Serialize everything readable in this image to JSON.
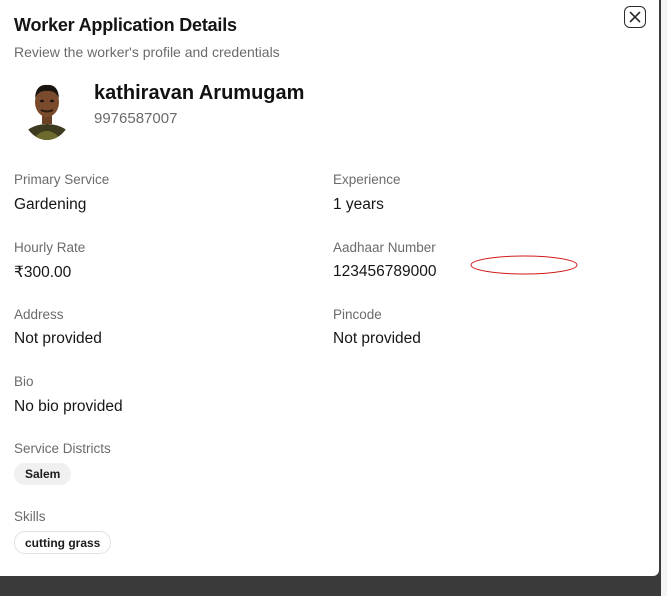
{
  "dialog": {
    "title": "Worker Application Details",
    "subtitle": "Review the worker's profile and credentials",
    "close_icon": "close-icon"
  },
  "worker": {
    "name": "kathiravan Arumugam",
    "phone": "9976587007",
    "avatar_icon": "worker-photo"
  },
  "fields": {
    "primary_service": {
      "label": "Primary Service",
      "value": "Gardening"
    },
    "experience": {
      "label": "Experience",
      "value": "1 years"
    },
    "hourly_rate": {
      "label": "Hourly Rate",
      "value": "₹300.00"
    },
    "aadhaar": {
      "label": "Aadhaar Number",
      "value": "123456789000"
    },
    "address": {
      "label": "Address",
      "value": "Not provided"
    },
    "pincode": {
      "label": "Pincode",
      "value": "Not provided"
    },
    "bio": {
      "label": "Bio",
      "value": "No bio provided"
    }
  },
  "service_districts": {
    "label": "Service Districts",
    "items": [
      "Salem"
    ]
  },
  "skills": {
    "label": "Skills",
    "items": [
      "cutting grass"
    ]
  },
  "colors": {
    "annotation": "#d11a1a",
    "backdrop": "#3a3a3a"
  }
}
